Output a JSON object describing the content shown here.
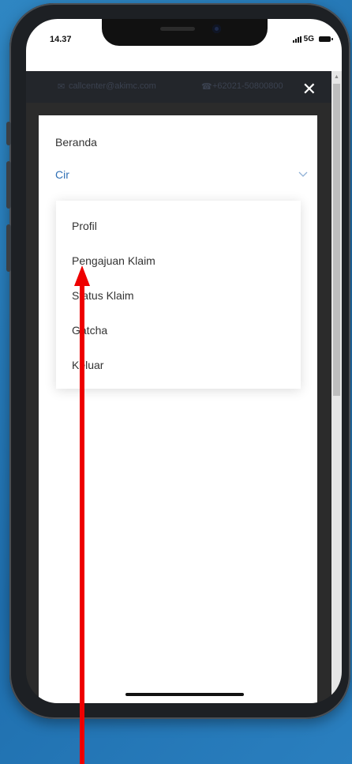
{
  "status_bar": {
    "time": "14.37",
    "network": "5G"
  },
  "topbar": {
    "email": "callcenter@akimc.com",
    "phone": "+62021-50800800"
  },
  "icons": {
    "close": "close-icon",
    "chevron": "chevron-down-icon",
    "email": "mail-icon",
    "phone": "phone-icon"
  },
  "drawer": {
    "home_label": "Beranda",
    "dropdown_value": "Cir",
    "menu_items": [
      "Profil",
      "Pengajuan Klaim",
      "Status Klaim",
      "Gatcha",
      "Keluar"
    ]
  },
  "colors": {
    "accent": "#2f6fb5",
    "annotation_arrow": "#ee0000",
    "background": "#1f6fae"
  }
}
